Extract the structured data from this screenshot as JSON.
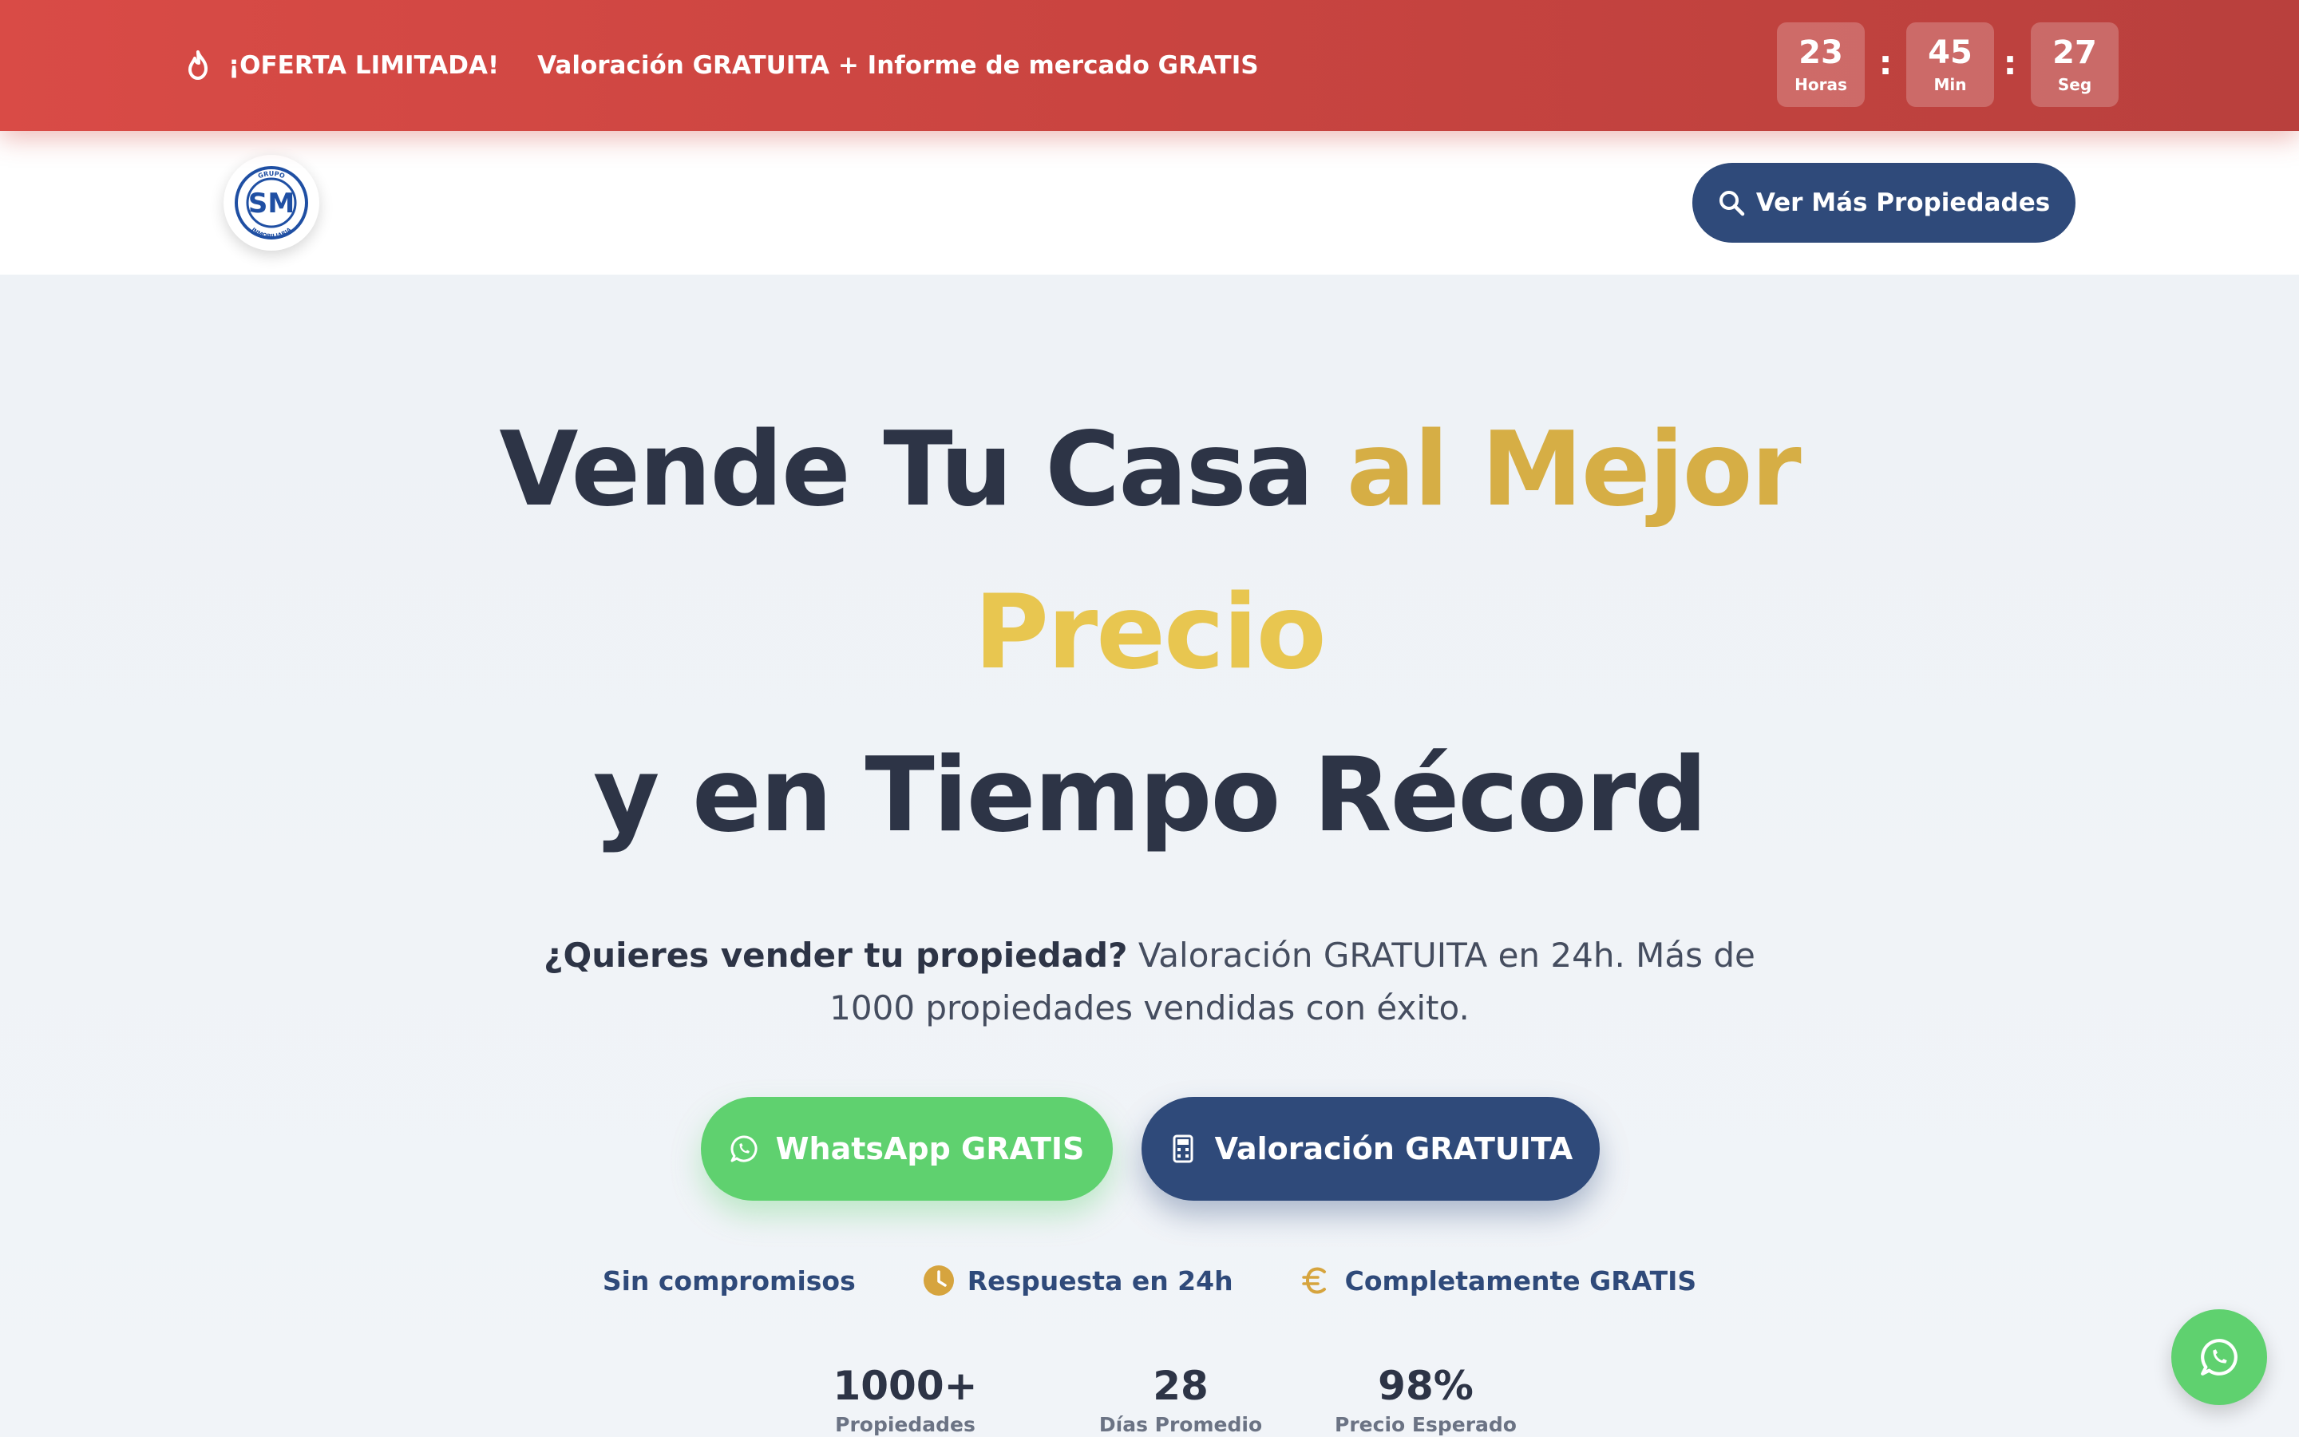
{
  "promo": {
    "icon": "fire-icon",
    "label": "¡OFERTA LIMITADA!",
    "text": "Valoración GRATUITA + Informe de mercado GRATIS",
    "color": "#d94b46"
  },
  "countdown": {
    "hours": "23",
    "hours_label": "Horas",
    "minutes": "45",
    "minutes_label": "Min",
    "seconds": "27",
    "seconds_label": "Seg",
    "separator": ":"
  },
  "header": {
    "logo_text_top": "GRUPO",
    "logo_monogram": "SM",
    "logo_text_bottom": "INMOBILIARIA",
    "more_button": "Ver Más Propiedades",
    "more_button_icon": "search-icon"
  },
  "hero": {
    "title_part1": "Vende Tu Casa",
    "title_part2": "al Mejor",
    "title_part3": "Precio",
    "title_part4": "y en Tiempo Récord",
    "subtitle_bold": "¿Quieres vender tu propiedad?",
    "subtitle_rest": " Valoración GRATUITA en 24h. Más de 1000 propiedades vendidas con éxito.",
    "accent_gold": "#d6ae45"
  },
  "cta": {
    "whatsapp": "WhatsApp GRATIS",
    "whatsapp_icon": "whatsapp-icon",
    "whatsapp_color": "#5fd16f",
    "valuation": "Valoración GRATUITA",
    "valuation_icon": "calculator-icon",
    "valuation_color": "#2f4a7a"
  },
  "features": [
    {
      "label": "Sin compromisos"
    },
    {
      "label": "Respuesta en 24h",
      "icon": "clock-icon"
    },
    {
      "label": "Completamente GRATIS",
      "icon": "euro-icon"
    }
  ],
  "stats": [
    {
      "value": "1000+",
      "label": "Propiedades Vendidas"
    },
    {
      "value": "28",
      "label": "Días Promedio"
    },
    {
      "value": "98%",
      "label": "Precio Esperado"
    }
  ]
}
